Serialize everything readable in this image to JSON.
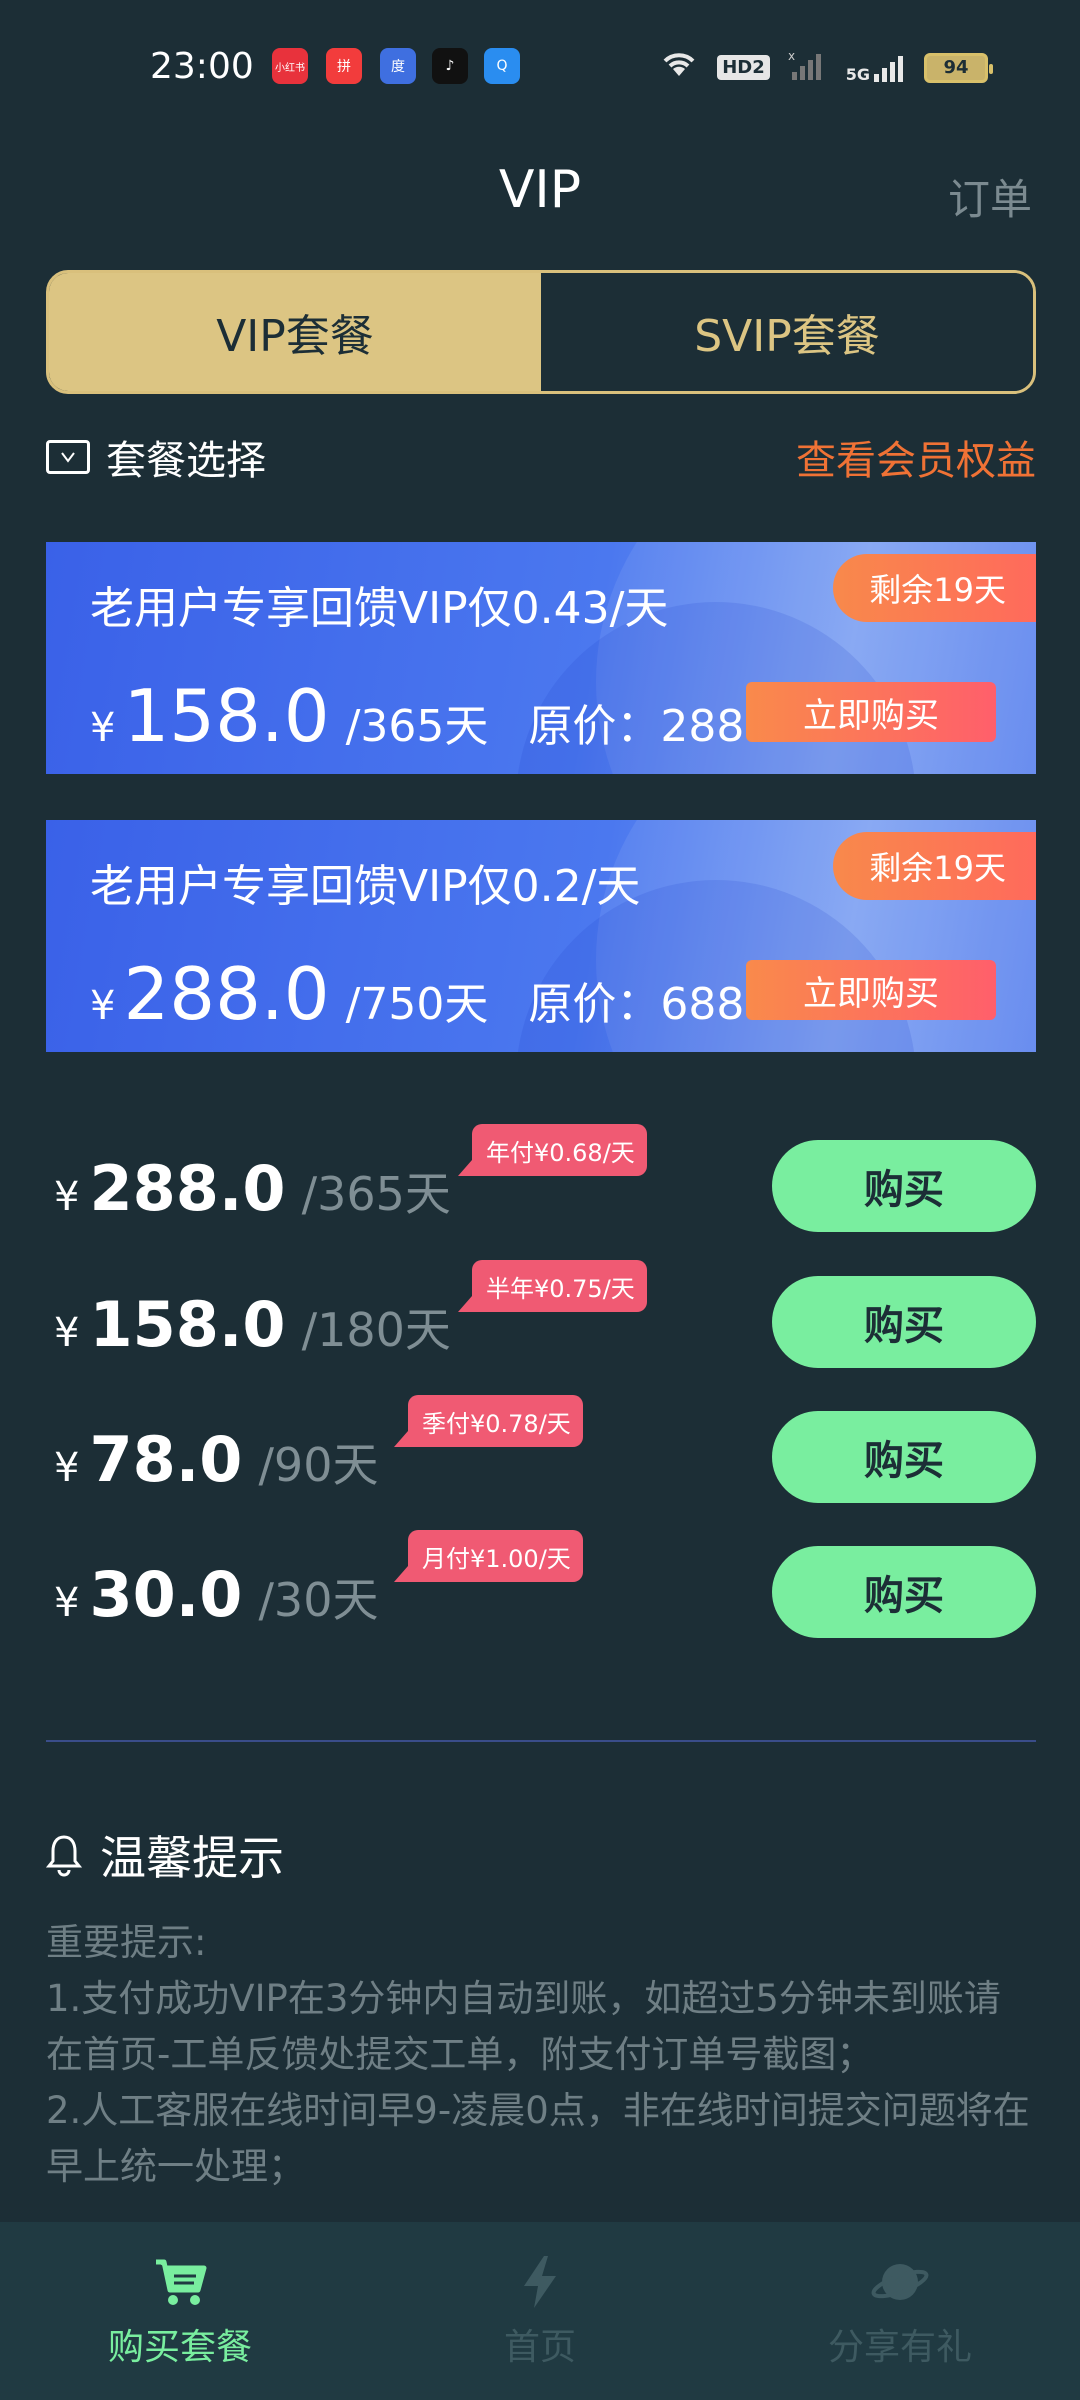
{
  "status_bar": {
    "time": "23:00",
    "apps": [
      "小红书",
      "拼",
      "度",
      "♪",
      "Q"
    ],
    "hd_label": "HD2",
    "network_label": "5G",
    "battery": "94"
  },
  "header": {
    "title": "VIP",
    "orders_label": "订单"
  },
  "tabs": [
    {
      "label": "VIP套餐",
      "active": true
    },
    {
      "label": "SVIP套餐",
      "active": false
    }
  ],
  "section": {
    "title": "套餐选择",
    "benefits_link": "查看会员权益"
  },
  "promos": [
    {
      "title": "老用户专享回馈VIP仅0.43/天",
      "remaining": "剩余19天",
      "currency": "¥",
      "price": "158.0",
      "period": "/365天",
      "original": "原价：288.0",
      "buy_label": "立即购买"
    },
    {
      "title": "老用户专享回馈VIP仅0.2/天",
      "remaining": "剩余19天",
      "currency": "¥",
      "price": "288.0",
      "period": "/750天",
      "original": "原价：688.0",
      "buy_label": "立即购买"
    }
  ],
  "plans": [
    {
      "currency": "¥",
      "price": "288.0",
      "period": "/365天",
      "tag": "年付¥0.68/天",
      "buy_label": "购买"
    },
    {
      "currency": "¥",
      "price": "158.0",
      "period": "/180天",
      "tag": "半年¥0.75/天",
      "buy_label": "购买"
    },
    {
      "currency": "¥",
      "price": "78.0",
      "period": "/90天",
      "tag": "季付¥0.78/天",
      "buy_label": "购买"
    },
    {
      "currency": "¥",
      "price": "30.0",
      "period": "/30天",
      "tag": "月付¥1.00/天",
      "buy_label": "购买"
    }
  ],
  "tips": {
    "heading": "温馨提示",
    "lines": [
      "重要提示:",
      "1.支付成功VIP在3分钟内自动到账，如超过5分钟未到账请在首页-工单反馈处提交工单，附支付订单号截图；",
      "2.人工客服在线时间早9-凌晨0点，非在线时间提交问题将在早上统一处理；"
    ]
  },
  "bottom_nav": [
    {
      "label": "购买套餐",
      "icon": "cart-icon",
      "active": true
    },
    {
      "label": "首页",
      "icon": "lightning-icon",
      "active": false
    },
    {
      "label": "分享有礼",
      "icon": "planet-icon",
      "active": false
    }
  ],
  "colors": {
    "background": "#1c2e36",
    "gold": "#dcc583",
    "green": "#79ee9f",
    "orange": "#f07235",
    "tag_pink": "#f05a73"
  }
}
